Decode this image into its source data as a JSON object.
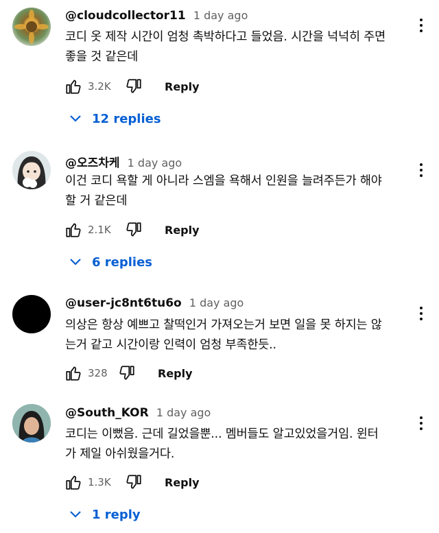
{
  "comments": [
    {
      "author": "@cloudcollector11",
      "time": "1 day ago",
      "text_lines": [
        "코디 옷 제작 시간이 엄청 촉박하다고 들었음. 시간을 넉넉히 주면",
        "좋을 것 같은데"
      ],
      "likes": "3.2K",
      "reply_label": "Reply",
      "replies_label": "12 replies"
    },
    {
      "author": "@오즈차케",
      "time": "1 day ago",
      "text_lines": [
        "이건 코디 욕할 게 아니라 스엠을 욕해서 인원을 늘려주든가 해야",
        "할 거 같은데"
      ],
      "likes": "2.1K",
      "reply_label": "Reply",
      "replies_label": "6 replies"
    },
    {
      "author": "@user-jc8nt6tu6o",
      "time": "1 day ago",
      "text_lines": [
        "의상은 항상 예쁘고 찰떡인거 가져오는거 보면 일을 못 하지는 않",
        "는거 같고 시간이랑 인력이 엄청 부족한듯.."
      ],
      "likes": "328",
      "reply_label": "Reply"
    },
    {
      "author": "@South_KOR",
      "time": "1 day ago",
      "text_lines": [
        "코디는 이뻤음. 근데 길었을뿐... 멤버들도 알고있었을거임. 윈터",
        "가 제일 아쉬웠을거다."
      ],
      "likes": "1.3K",
      "reply_label": "Reply",
      "replies_label": "1 reply"
    }
  ],
  "icons": {
    "like": "thumbs-up-icon",
    "dislike": "thumbs-down-icon",
    "more": "more-vert-icon",
    "expand": "chevron-down-icon"
  },
  "colors": {
    "link": "#065fd4",
    "secondary_text": "#606060",
    "primary_text": "#0f0f0f"
  }
}
